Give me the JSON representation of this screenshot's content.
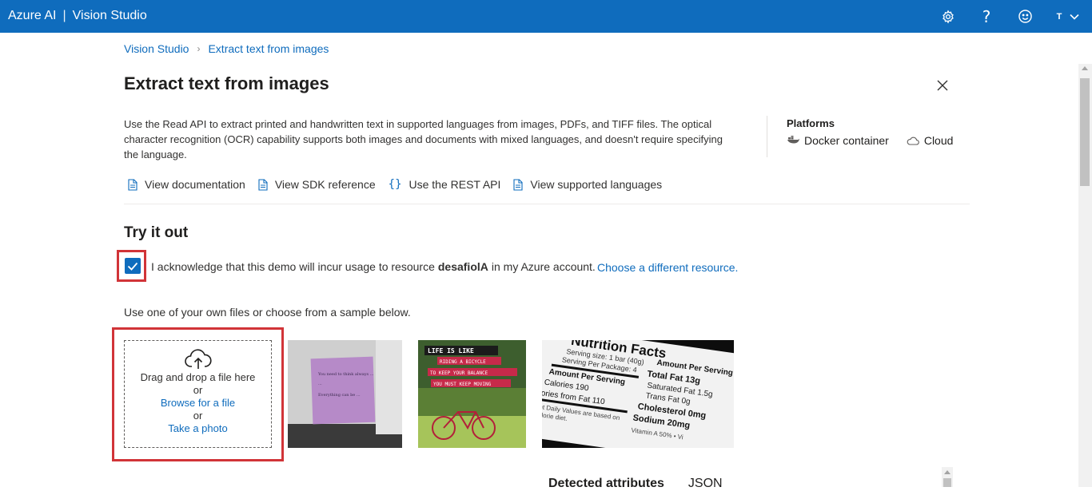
{
  "header": {
    "brand": "Azure AI",
    "separator": "|",
    "product": "Vision Studio",
    "user_initial": "T",
    "icons": [
      "gear-icon",
      "help-icon",
      "feedback-smiley-icon",
      "chevron-down-icon"
    ]
  },
  "breadcrumb": {
    "items": [
      "Vision Studio",
      "Extract text from images"
    ],
    "separator": "›"
  },
  "page": {
    "title": "Extract text from images",
    "description": "Use the Read API to extract printed and handwritten text in supported languages from images, PDFs, and TIFF files. The optical character recognition (OCR) capability supports both images and documents with mixed languages, and doesn't require specifying the language."
  },
  "platforms": {
    "title": "Platforms",
    "items": [
      {
        "label": "Docker container",
        "icon": "docker-icon"
      },
      {
        "label": "Cloud",
        "icon": "cloud-icon"
      }
    ]
  },
  "doc_links": [
    {
      "label": "View documentation",
      "icon": "document-icon"
    },
    {
      "label": "View SDK reference",
      "icon": "document-icon"
    },
    {
      "label": "Use the REST API",
      "icon": "braces-icon"
    },
    {
      "label": "View supported languages",
      "icon": "document-icon"
    }
  ],
  "try_it": {
    "title": "Try it out",
    "ack_checked": true,
    "ack_prefix": "I acknowledge that this demo will incur usage to resource",
    "ack_resource": "desafiolA",
    "ack_suffix": "in my Azure account.",
    "change_resource": "Choose a different resource.",
    "files_prompt": "Use one of your own files or choose from a sample below."
  },
  "upload": {
    "drag_text": "Drag and drop a file here",
    "or1": "or",
    "browse": "Browse for a file",
    "or2": "or",
    "photo": "Take a photo"
  },
  "samples": {
    "sticky_note_lines": [
      "You need to think always ...",
      "...",
      "Everything can be ..."
    ],
    "bicycle_lines": [
      "LIFE IS LIKE",
      "RIDING A BICYCLE",
      "TO KEEP YOUR BALANCE",
      "YOU MUST KEEP MOVING"
    ],
    "nutrition": {
      "title": "Nutrition Facts",
      "serving_size": "Serving size: 1 bar (40g)",
      "servings": "Serving Per Package: 4",
      "left_header": "Amount Per Serving",
      "calories": "Calories 190",
      "fat_cal": "ories from Fat 110",
      "note1": "nt Daily Values are based on",
      "note2": "alorie diet.",
      "right_header": "Amount Per Serving",
      "total_fat": "Total Fat 13g",
      "sat_fat": "Saturated Fat 1.5g",
      "trans_fat": "Trans Fat 0g",
      "cholesterol": "Cholesterol 0mg",
      "sodium": "Sodium 20mg",
      "vitamin": "Vitamin A 50% • Vi"
    }
  },
  "results": {
    "tabs": [
      "Detected attributes",
      "JSON"
    ]
  },
  "colors": {
    "topbar": "#0f6cbd",
    "link": "#0f6cbd",
    "highlight": "#d13438"
  }
}
